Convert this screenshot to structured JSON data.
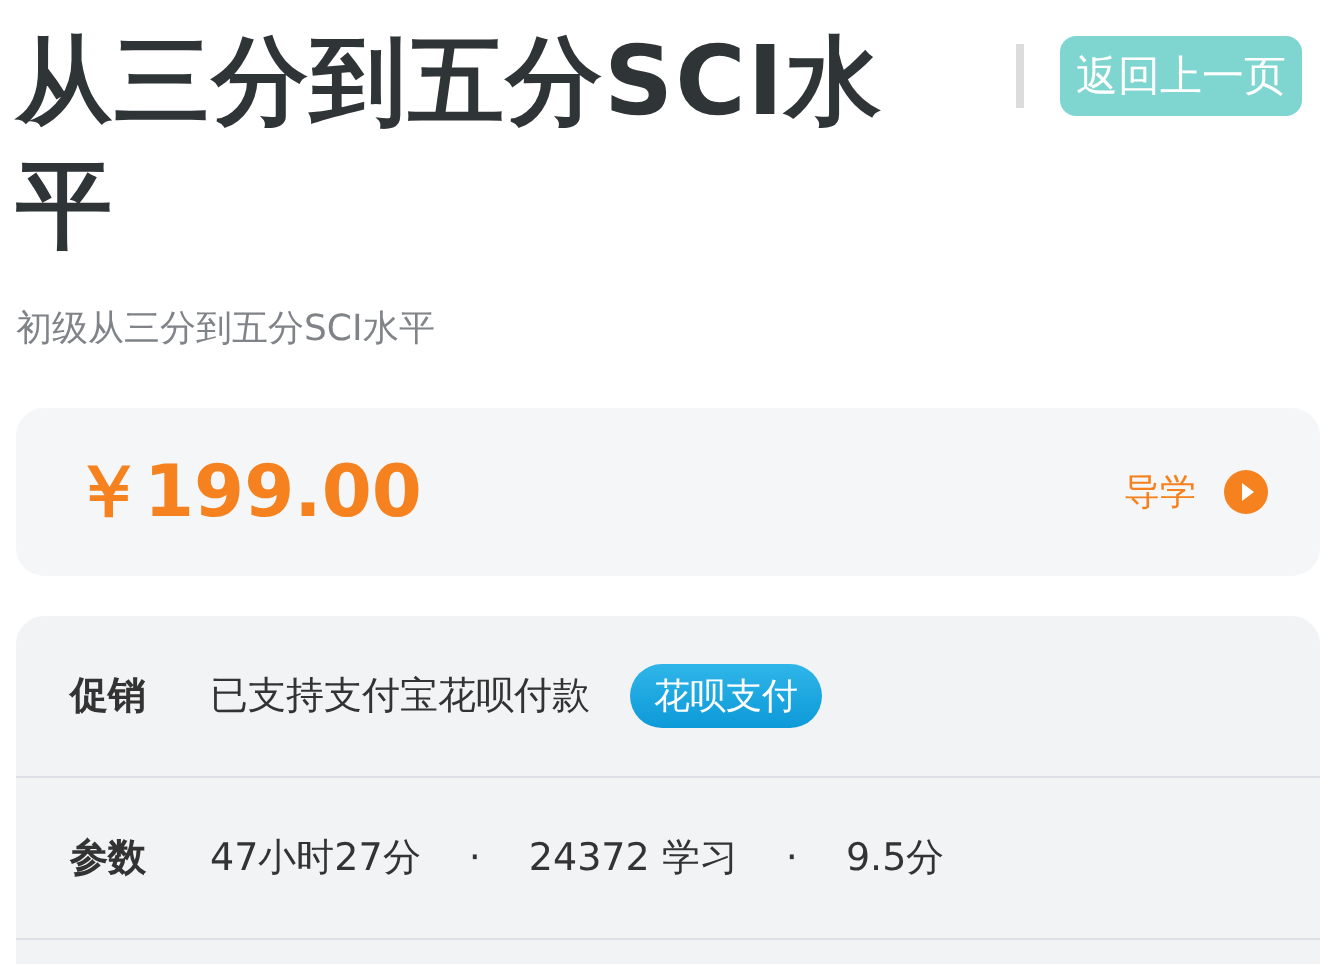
{
  "header": {
    "title": "从三分到五分SCI水平",
    "back_button": "返回上一页"
  },
  "subtitle": "初级从三分到五分SCI水平",
  "price_card": {
    "price": "￥199.00",
    "guide_link": "导学"
  },
  "info_rows": [
    {
      "kind": "promo",
      "label": "促销",
      "text": "已支持支付宝花呗付款",
      "badge": "花呗支付"
    },
    {
      "kind": "params",
      "label": "参数",
      "items": [
        "47小时27分",
        "·",
        "24372 学习",
        "·",
        "9.5分"
      ]
    }
  ]
}
